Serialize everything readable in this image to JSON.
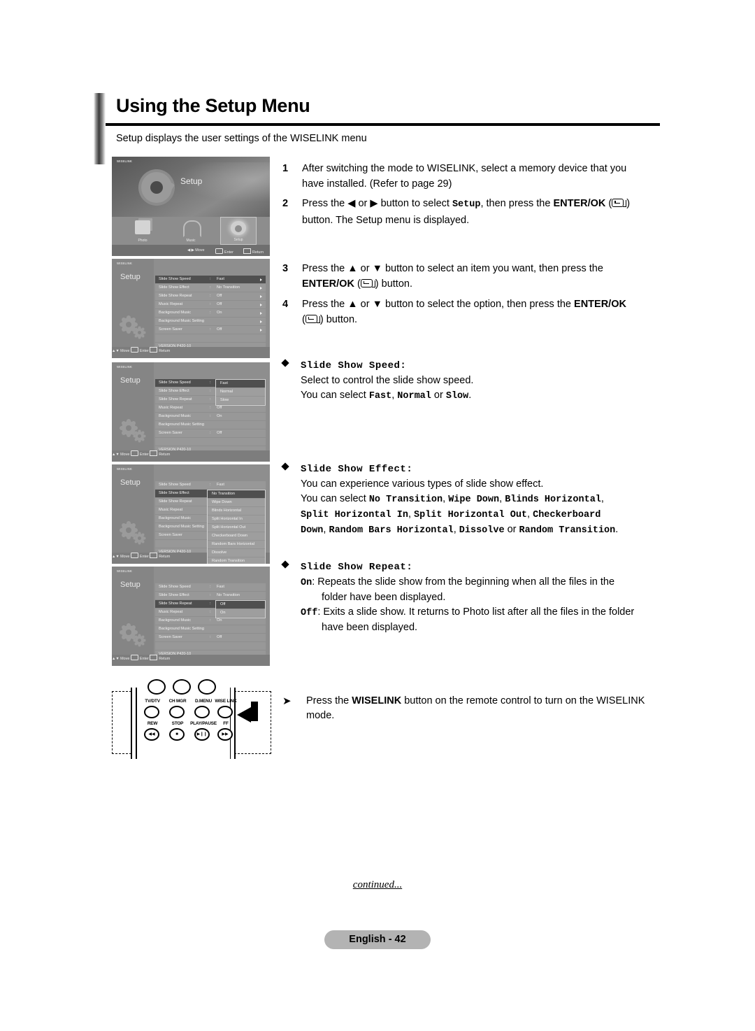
{
  "header": {
    "title": "Using the Setup Menu",
    "intro": "Setup displays the user settings of the WISELINK menu"
  },
  "steps": [
    {
      "num": "1",
      "line1": "After switching the mode to WISELINK, select a memory device that you",
      "line2": "have installed. (Refer to page 29)"
    },
    {
      "num": "2",
      "t1": "Press the ",
      "arrow_left": "◀",
      "t2": " or ",
      "arrow_right": "▶",
      "t3": " button to select ",
      "mono1": "Setup",
      "t4": ", then press the ",
      "bold1": "ENTER/OK",
      "t5": ")",
      "line2": "button. The Setup menu is displayed."
    },
    {
      "num": "3",
      "t1": "Press the ",
      "arrow_up": "▲",
      "t2": " or ",
      "arrow_down": "▼",
      "t3": " button to select an item you want, then press the",
      "bold1": "ENTER/OK",
      "t4": "(",
      "t5": ") button."
    },
    {
      "num": "4",
      "t1": "Press the ",
      "arrow_up": "▲",
      "t2": " or ",
      "arrow_down": "▼",
      "t3": " button to select the option, then press the ",
      "bold1": "ENTER/OK",
      "t4": "(",
      "t5": ") button."
    }
  ],
  "bullets": [
    {
      "heading": "Slide Show Speed:",
      "line1": "Select to control the slide show speed.",
      "l2_pre": "You can select ",
      "l2_opt1": "Fast",
      "l2_sep1": ", ",
      "l2_opt2": "Normal",
      "l2_sep2": " or ",
      "l2_opt3": "Slow",
      "l2_end": "."
    },
    {
      "heading": "Slide Show Effect:",
      "line1": "You can experience various types of slide show effect.",
      "l2_pre": "You can select ",
      "opts_line1": [
        "No Transition",
        "Wipe Down",
        "Blinds Horizontal"
      ],
      "opts_line2": [
        "Split Horizontal In",
        "Split Horizontal Out",
        "Checkerboard"
      ],
      "opts_line3": [
        "Down",
        "Random Bars Horizontal",
        "Dissolve"
      ],
      "or_text": " or ",
      "last_opt": "Random Transition",
      "end": "."
    },
    {
      "heading": "Slide Show Repeat:",
      "on_label": "On",
      "on_text1": ":  Repeats the slide show from the beginning when all the files in the",
      "on_text2": "folder have been displayed.",
      "off_label": "Off",
      "off_text1": ": Exits a slide show. It returns to Photo list after all the files in the folder",
      "off_text2": "have been displayed."
    }
  ],
  "shots": {
    "logo": "WISELINK",
    "splash": {
      "heading": "Setup",
      "icons": [
        {
          "label": "Photo",
          "art": "photo-icon"
        },
        {
          "label": "Music",
          "art": "music-icon"
        },
        {
          "label": "Setup",
          "art": "setup-gear-icon"
        }
      ],
      "foot_move": "Move",
      "foot_move_arrows": "◀ ▶",
      "foot_enter": "Enter",
      "foot_return": "Return"
    },
    "menu_title": "Setup",
    "version": "VERSION P420-10",
    "foot_move": "Move",
    "foot_move_arrows": "▲▼",
    "foot_enter": "Enter",
    "foot_return": "Return",
    "rows": [
      {
        "label": "Slide Show Speed",
        "value": "Fast"
      },
      {
        "label": "Slide Show Effect",
        "value": "No Transition"
      },
      {
        "label": "Slide Show Repeat",
        "value": "Off"
      },
      {
        "label": "Music Repeat",
        "value": "Off"
      },
      {
        "label": "Background Music",
        "value": "On"
      },
      {
        "label": "Background Music Setting",
        "value": ""
      },
      {
        "label": "Screen Saver",
        "value": "Off"
      }
    ],
    "dropdown_speed": [
      "Fast",
      "Normal",
      "Slow"
    ],
    "dropdown_effect": [
      "No Transition",
      "Wipe Down",
      "Blinds Horizontal",
      "Split Horizontal In",
      "Split Horizontal Out",
      "Checkerboard Down",
      "Random Bars Horizontal",
      "Dissolve",
      "Random Transition"
    ],
    "dropdown_repeat": [
      "Off",
      "On"
    ]
  },
  "remote": {
    "top_labels": [
      "TV/DTV",
      "CH MGR",
      "D.MENU",
      "WISE LINK"
    ],
    "bottom_labels": [
      "REW",
      "STOP",
      "PLAY/PAUSE",
      "FF"
    ],
    "bottom_glyphs": [
      "◀◀",
      "■",
      "▶❙❙",
      "▶▶"
    ]
  },
  "note": {
    "glyph": "➤",
    "pre": "Press the ",
    "bold": "WISELINK",
    "post": " button on the remote control to turn on the WISELINK",
    "line2": "mode."
  },
  "footer": {
    "continued": "continued...",
    "page": "English - 42"
  }
}
